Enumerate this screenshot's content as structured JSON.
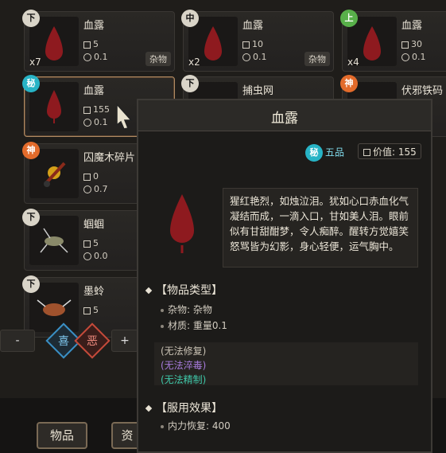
{
  "items": [
    {
      "grade": "下",
      "name": "血露",
      "value": "5",
      "weight": "0.1",
      "qty": "x7",
      "tag": "杂物"
    },
    {
      "grade": "中",
      "name": "血露",
      "value": "10",
      "weight": "0.1",
      "qty": "x2",
      "tag": "杂物"
    },
    {
      "grade": "上",
      "name": "血露",
      "value": "30",
      "weight": "0.1",
      "qty": "x4",
      "tag": ""
    },
    {
      "grade": "秘",
      "name": "血露",
      "value": "155",
      "weight": "0.1",
      "qty": "",
      "tag": ""
    },
    {
      "grade": "下",
      "name": "捕虫网",
      "value": "",
      "weight": "",
      "qty": "",
      "tag": ""
    },
    {
      "grade": "神",
      "name": "伏邪铁码",
      "value": "",
      "weight": "",
      "qty": "",
      "tag": ""
    },
    {
      "grade": "神",
      "name": "囚魔木碎片",
      "value": "0",
      "weight": "0.7",
      "qty": "",
      "tag": ""
    },
    {
      "grade": "下",
      "name": "蝈蝈",
      "value": "5",
      "weight": "0.0",
      "qty": "",
      "tag": ""
    },
    {
      "grade": "下",
      "name": "墨蛉",
      "value": "5",
      "weight": "",
      "qty": "",
      "tag": ""
    }
  ],
  "tooltip": {
    "title": "血露",
    "rank_badge": "秘",
    "rank_label": "五品",
    "value_label": "价值: 155",
    "description": "猩红艳烈，如烛泣泪。犹如心口赤血化气凝结而成，一滴入口，甘如美人泪。眼前似有甘甜酣梦，令人痴醉。醒转方觉嬉笑怒骂皆为幻影，身心轻便，运气胸中。",
    "section_type_title": "【物品类型】",
    "type_lines": [
      "杂物: 杂物",
      "材质: 重量0.1"
    ],
    "status_lines": [
      {
        "text": "(无法修复)",
        "color": "#c9c2b4"
      },
      {
        "text": "(无法淬毒)",
        "color": "#a77bdc"
      },
      {
        "text": "(无法精制)",
        "color": "#3fc7a8"
      }
    ],
    "section_effect_title": "【服用效果】",
    "effect_lines": [
      "内力恢复: 400"
    ]
  },
  "controls": {
    "minus": "-",
    "like": "喜",
    "dislike": "恶",
    "plus": "+"
  },
  "tabs": [
    "物品",
    "资"
  ],
  "colors": {
    "blood": "#8e1a1f",
    "rank_cyan": "#27b3c5",
    "border_gold": "#b08a63"
  }
}
